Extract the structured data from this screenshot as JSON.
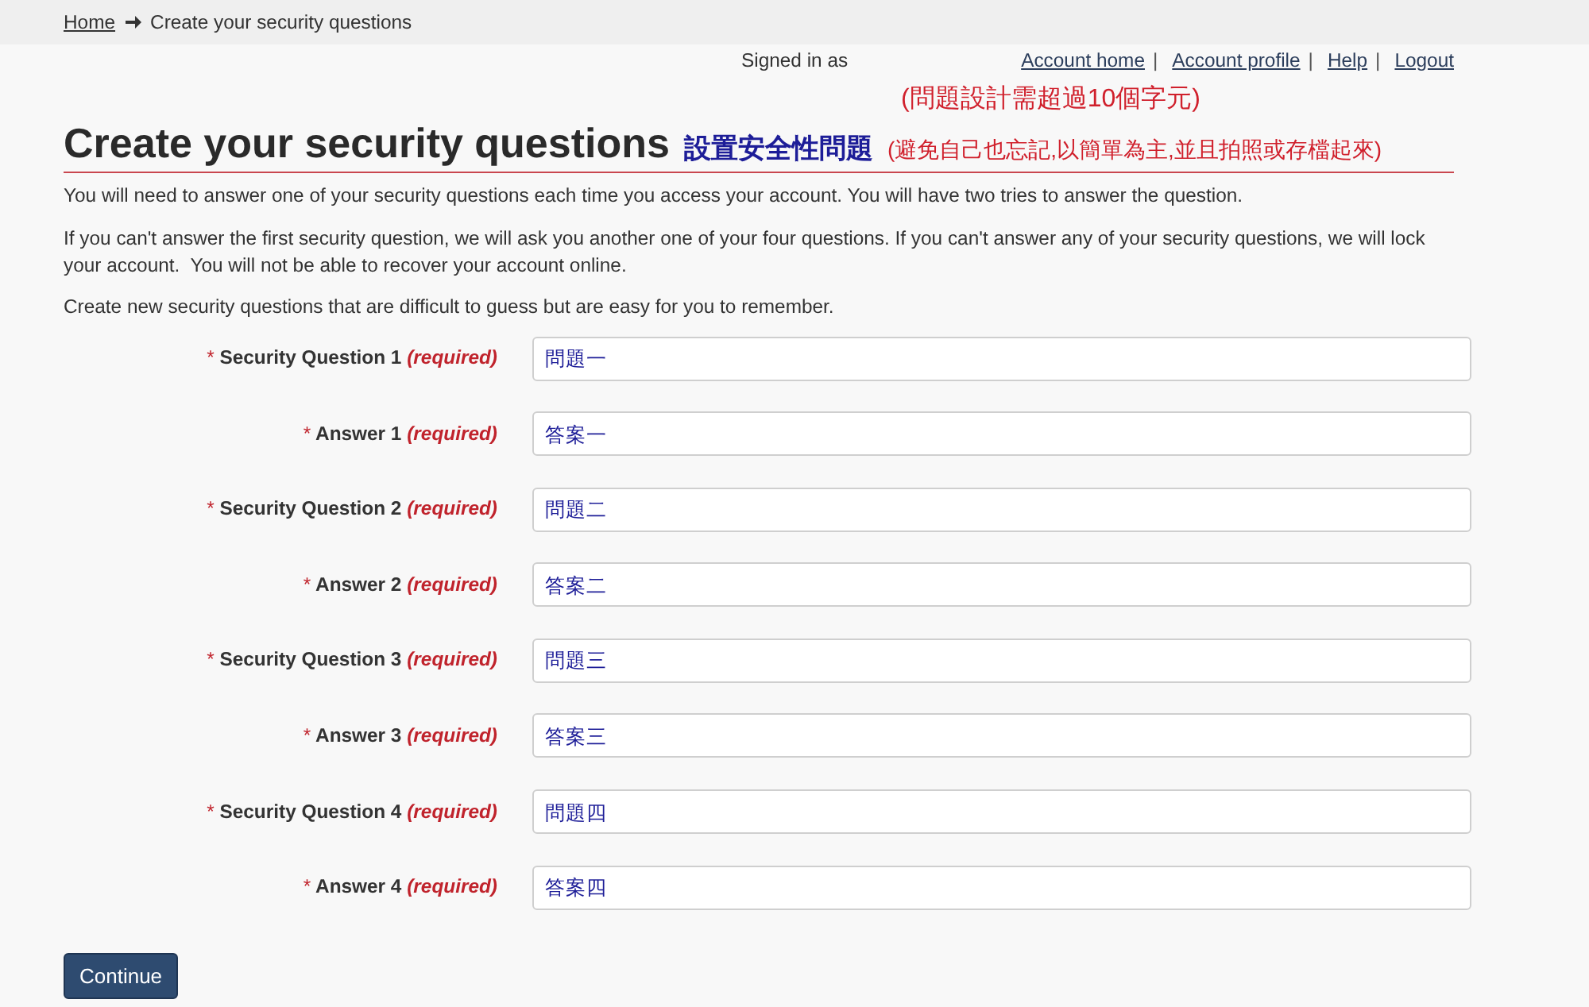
{
  "breadcrumb": [
    {
      "label": "Home",
      "kind": "link"
    },
    {
      "label": "Create your security questions",
      "kind": "current"
    }
  ],
  "account_bar": {
    "signed_in_label": "Signed in as",
    "links": [
      {
        "label": "Account home",
        "separator": "|"
      },
      {
        "label": "Account profile",
        "separator": "|"
      },
      {
        "label": "Help",
        "separator": "|"
      },
      {
        "label": "Logout"
      }
    ]
  },
  "heading": {
    "note_above": "(問題設計需超過10個字元)",
    "title": "Create your security questions",
    "title_translation": "設置安全性問題",
    "title_note": "(避免自己也忘記,以簡單為主,並且拍照或存檔起來)"
  },
  "intro": [
    "You will need to answer one of your security questions each time you access your account. You will have two tries to answer the question.",
    "If you can't answer the first security question, we will ask you another one of your four questions. If you can't answer any of your security questions, we will lock your account.  You will not be able to recover your account online.",
    "Create new security questions that are difficult to guess but are easy for you to remember."
  ],
  "fields": [
    {
      "required_mark": "*",
      "label": "Security Question 1",
      "required_note": "(required)",
      "value": "問題一"
    },
    {
      "required_mark": "*",
      "label": "Answer 1",
      "required_note": "(required)",
      "value": "答案一"
    },
    {
      "required_mark": "*",
      "label": "Security Question 2",
      "required_note": "(required)",
      "value": "問題二"
    },
    {
      "required_mark": "*",
      "label": "Answer 2",
      "required_note": "(required)",
      "value": "答案二"
    },
    {
      "required_mark": "*",
      "label": "Security Question 3",
      "required_note": "(required)",
      "value": "問題三"
    },
    {
      "required_mark": "*",
      "label": "Answer 3",
      "required_note": "(required)",
      "value": "答案三"
    },
    {
      "required_mark": "*",
      "label": "Security Question 4",
      "required_note": "(required)",
      "value": "問題四"
    },
    {
      "required_mark": "*",
      "label": "Answer 4",
      "required_note": "(required)",
      "value": "答案四"
    }
  ],
  "continue_button": "Continue"
}
